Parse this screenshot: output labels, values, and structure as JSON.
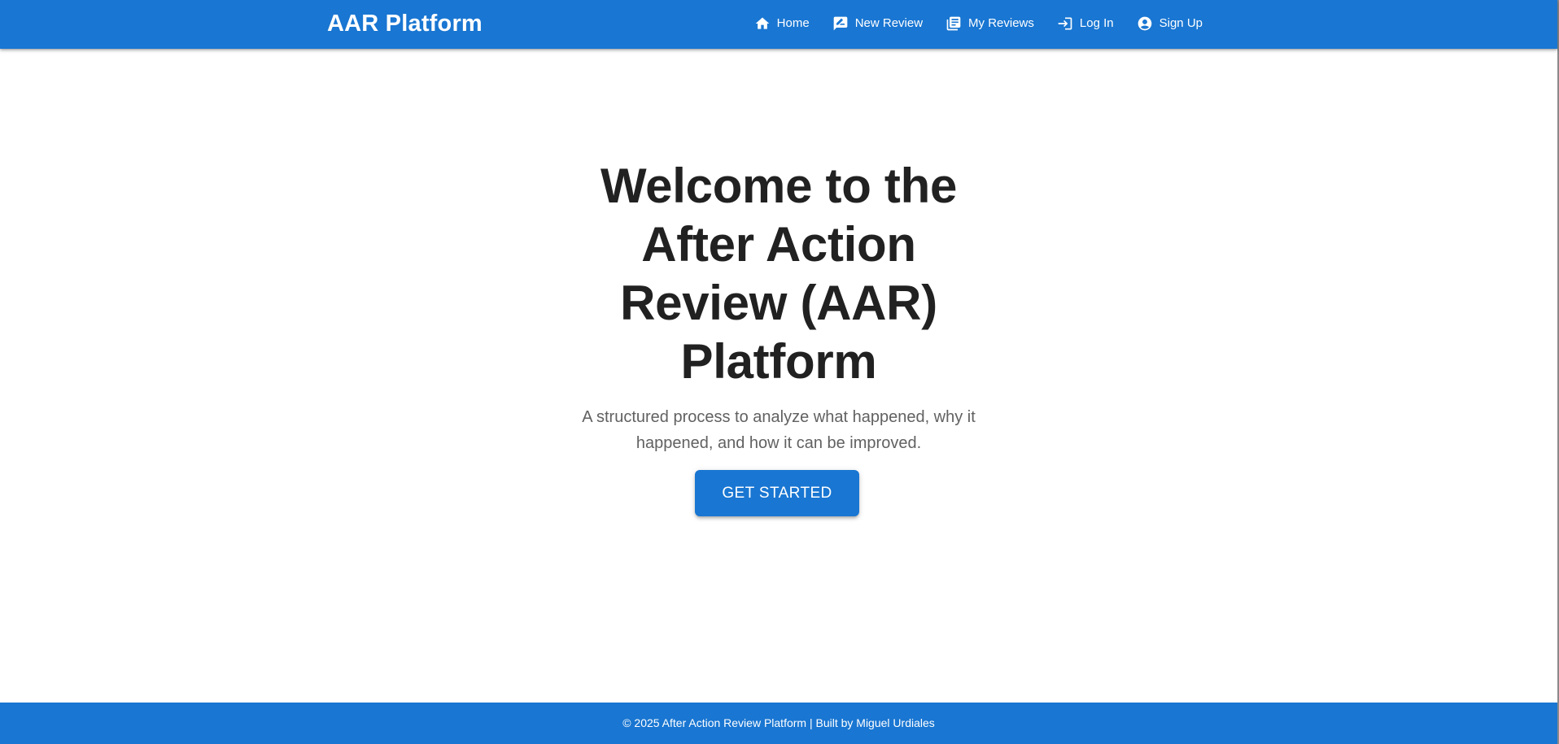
{
  "header": {
    "brand": "AAR Platform",
    "nav": [
      {
        "label": "Home",
        "icon": "home-icon"
      },
      {
        "label": "New Review",
        "icon": "rate-review-icon"
      },
      {
        "label": "My Reviews",
        "icon": "library-books-icon"
      },
      {
        "label": "Log In",
        "icon": "login-icon"
      },
      {
        "label": "Sign Up",
        "icon": "account-circle-icon"
      }
    ]
  },
  "hero": {
    "title": "Welcome to the After Action Review (AAR) Platform",
    "subtitle": "A structured process to analyze what happened, why it happened, and how it can be improved.",
    "cta_label": "Get Started"
  },
  "footer": {
    "text": "© 2025 After Action Review Platform | Built by Miguel Urdiales"
  },
  "colors": {
    "primary": "#1976d2",
    "heading": "#212121",
    "body_text": "#616161",
    "on_primary": "#ffffff"
  }
}
